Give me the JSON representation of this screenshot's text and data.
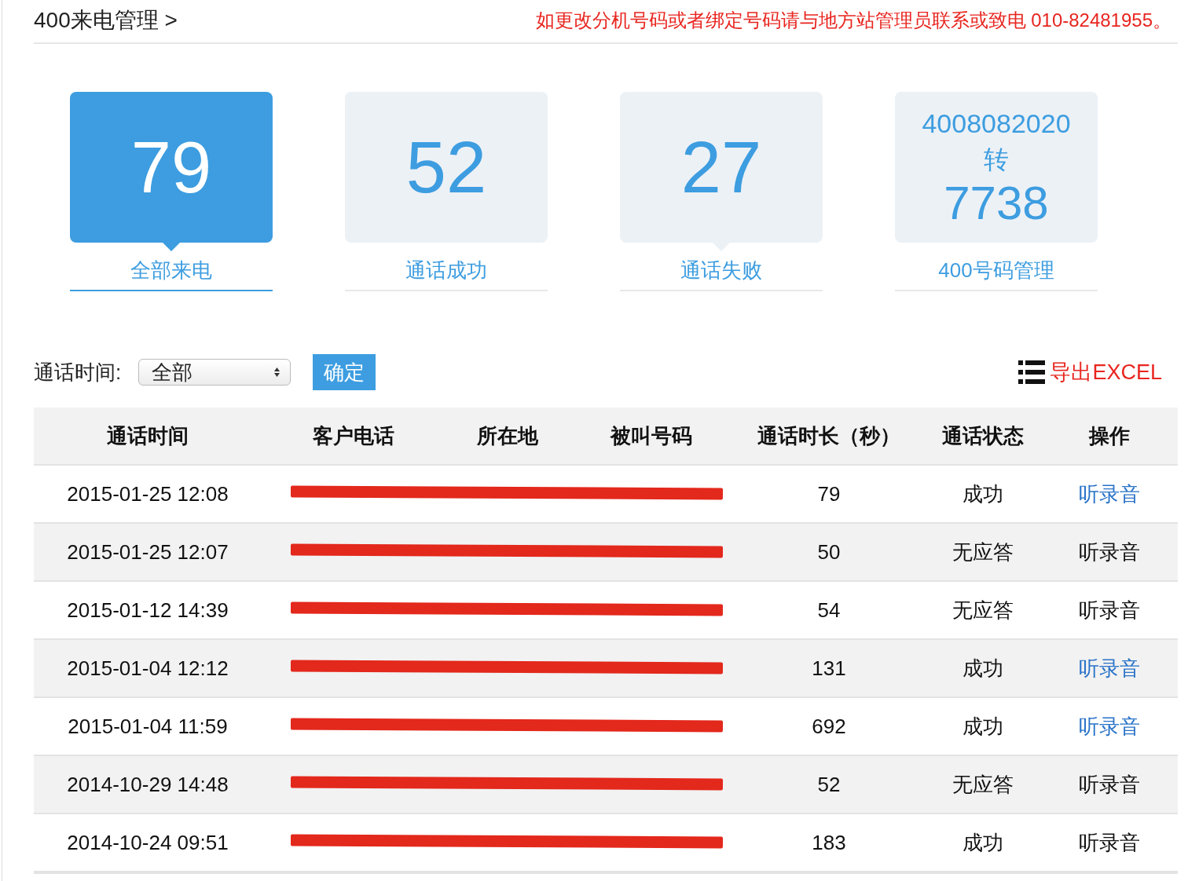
{
  "header": {
    "title": "400来电管理 >",
    "notice": "如更改分机号码或者绑定号码请与地方站管理员联系或致电 010-82481955。"
  },
  "stats": [
    {
      "kind": "count",
      "value": "79",
      "label": "全部来电",
      "selected": true,
      "pointer": true
    },
    {
      "kind": "count",
      "value": "52",
      "label": "通话成功",
      "selected": false,
      "pointer": false
    },
    {
      "kind": "count",
      "value": "27",
      "label": "通话失败",
      "selected": false,
      "pointer": true
    },
    {
      "kind": "number",
      "lines": [
        "4008082020",
        "转",
        "7738"
      ],
      "label": "400号码管理",
      "selected": false,
      "pointer": false
    }
  ],
  "filter": {
    "label": "通话时间:",
    "select_value": "全部",
    "confirm": "确定",
    "export": "导出EXCEL"
  },
  "table": {
    "columns": [
      "通话时间",
      "客户电话",
      "所在地",
      "被叫号码",
      "通话时长（秒）",
      "通话状态",
      "操作"
    ],
    "rows": [
      {
        "time": "2015-01-25 12:08",
        "redacted": true,
        "duration": "79",
        "status": "成功",
        "action": "听录音",
        "playable": true
      },
      {
        "time": "2015-01-25 12:07",
        "redacted": true,
        "duration": "50",
        "status": "无应答",
        "action": "听录音",
        "playable": false
      },
      {
        "time": "2015-01-12 14:39",
        "redacted": true,
        "duration": "54",
        "status": "无应答",
        "action": "听录音",
        "playable": false
      },
      {
        "time": "2015-01-04 12:12",
        "redacted": true,
        "duration": "131",
        "status": "成功",
        "action": "听录音",
        "playable": true
      },
      {
        "time": "2015-01-04 11:59",
        "redacted": true,
        "duration": "692",
        "status": "成功",
        "action": "听录音",
        "playable": true
      },
      {
        "time": "2014-10-29 14:48",
        "redacted": true,
        "duration": "52",
        "status": "无应答",
        "action": "听录音",
        "playable": false
      },
      {
        "time": "2014-10-24 09:51",
        "redacted": true,
        "duration": "183",
        "status": "成功",
        "action": "听录音",
        "playable": false
      }
    ]
  }
}
